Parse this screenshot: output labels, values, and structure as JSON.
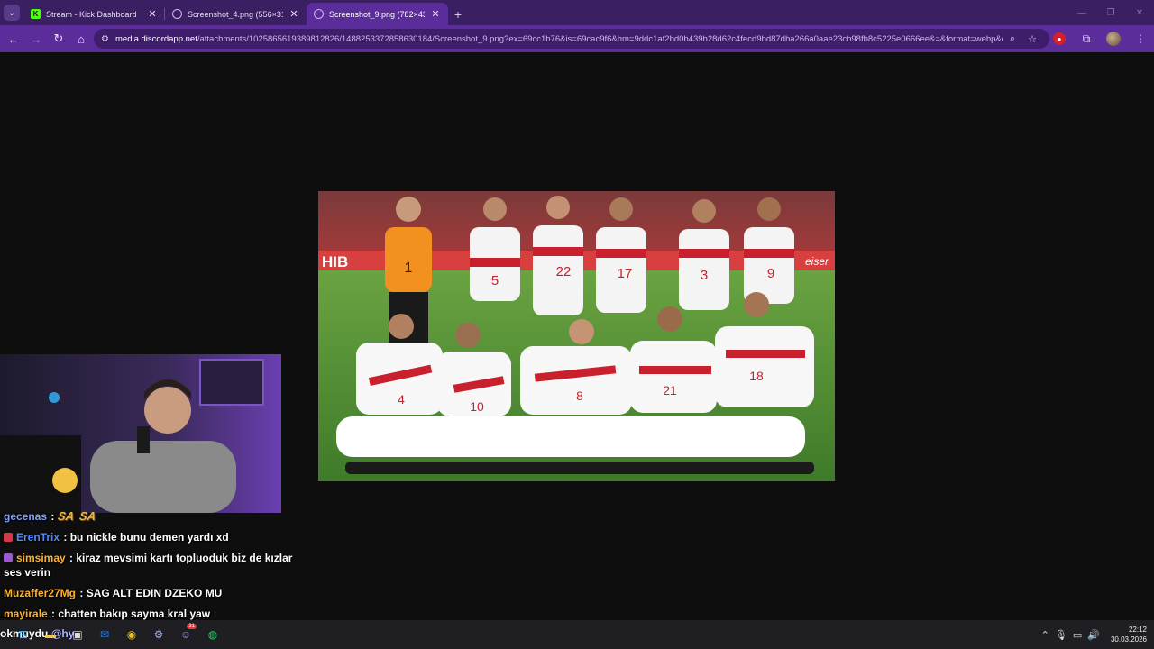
{
  "browser": {
    "tabs": [
      {
        "title": "Stream - Kick Dashboard",
        "favicon": "kick-icon",
        "active": false
      },
      {
        "title": "Screenshot_4.png (556×312)",
        "favicon": "globe-icon",
        "active": false
      },
      {
        "title": "Screenshot_9.png (782×439)",
        "favicon": "globe-icon",
        "active": true
      }
    ],
    "url_host": "media.discordapp.net",
    "url_path": "/attachments/1025865619389812826/1488253372858630184/Screenshot_9.png?ex=69cc1b76&is=69cac9f6&hm=9ddc1af2bd0b439b28d62c4fecd9bd87dba266a0aae23cb98fb8c5225e0666ee&=&format=webp&qu...",
    "accent_color": "#5a2d9a"
  },
  "image": {
    "description_kind": "team-photo",
    "sponsor_left": "HIB",
    "sponsor_right": "eiser",
    "jersey_numbers_back": [
      "1",
      "5",
      "22",
      "17",
      "3",
      "9"
    ],
    "jersey_numbers_front": [
      "4",
      "10",
      "8",
      "21",
      "18"
    ]
  },
  "chat": [
    {
      "user": "gecenas",
      "color": "#7fa0ff",
      "badge": "",
      "text": "",
      "emotes": [
        "SA",
        "SA"
      ]
    },
    {
      "user": "ErenTrix",
      "color": "#4a8cff",
      "badge": "#d23a4a",
      "text": "bu nickle bunu demen yardı xd"
    },
    {
      "user": "simsimay",
      "color": "#ffb02e",
      "badge": "#9b59d0",
      "text": "kiraz mevsimi kartı topluoduk biz de kızlar ses verin"
    },
    {
      "user": "Muzaffer27Mg",
      "color": "#ffb02e",
      "badge": "",
      "text": "SAG ALT EDIN DZEKO MU"
    },
    {
      "user": "mayirale",
      "color": "#ffb02e",
      "badge": "",
      "text": "chatten bakıp sayma kral yaw"
    }
  ],
  "taskbar": {
    "partial_user": "okmuydu",
    "partial_mention": "@hy",
    "time": "22:12",
    "date": "30.03.2026",
    "discord_badge": "31"
  }
}
